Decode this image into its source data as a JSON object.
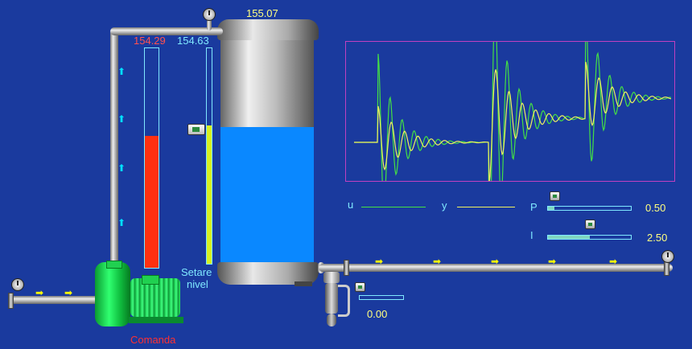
{
  "tank": {
    "top_value": "155.07",
    "level": 0.61
  },
  "readouts": {
    "command_value": "154.29",
    "setpoint_value": "154.63"
  },
  "labels": {
    "setpoint_line1": "Setare",
    "setpoint_line2": "nivel",
    "pump_label": "Comanda"
  },
  "legend": {
    "u_label": "u",
    "y_label": "y"
  },
  "controls": {
    "p_label": "P",
    "p_value": "0.50",
    "p_fraction": 0.08,
    "i_label": "I",
    "i_value": "2.50",
    "i_fraction": 0.5,
    "outlet_value": "0.00",
    "outlet_fraction": 0.0
  },
  "bars": {
    "command_fraction": 0.6,
    "setpoint_fraction": 0.64
  },
  "colors": {
    "background": "#1a3a9e",
    "u_line": "#44e044",
    "y_line": "#f0f060",
    "command_bar": "#ff3010",
    "setpoint_bar": "#d8f020",
    "water": "#0a88ff",
    "command_text": "#ff5050",
    "value_text": "#ffff80",
    "label_text": "#7fe8ff"
  },
  "icons": {
    "gauge": "pressure-gauge-icon",
    "flow_arrow": "flow-arrow-icon",
    "pump": "pump-icon",
    "motor": "motor-icon",
    "valve": "valve-icon"
  }
}
